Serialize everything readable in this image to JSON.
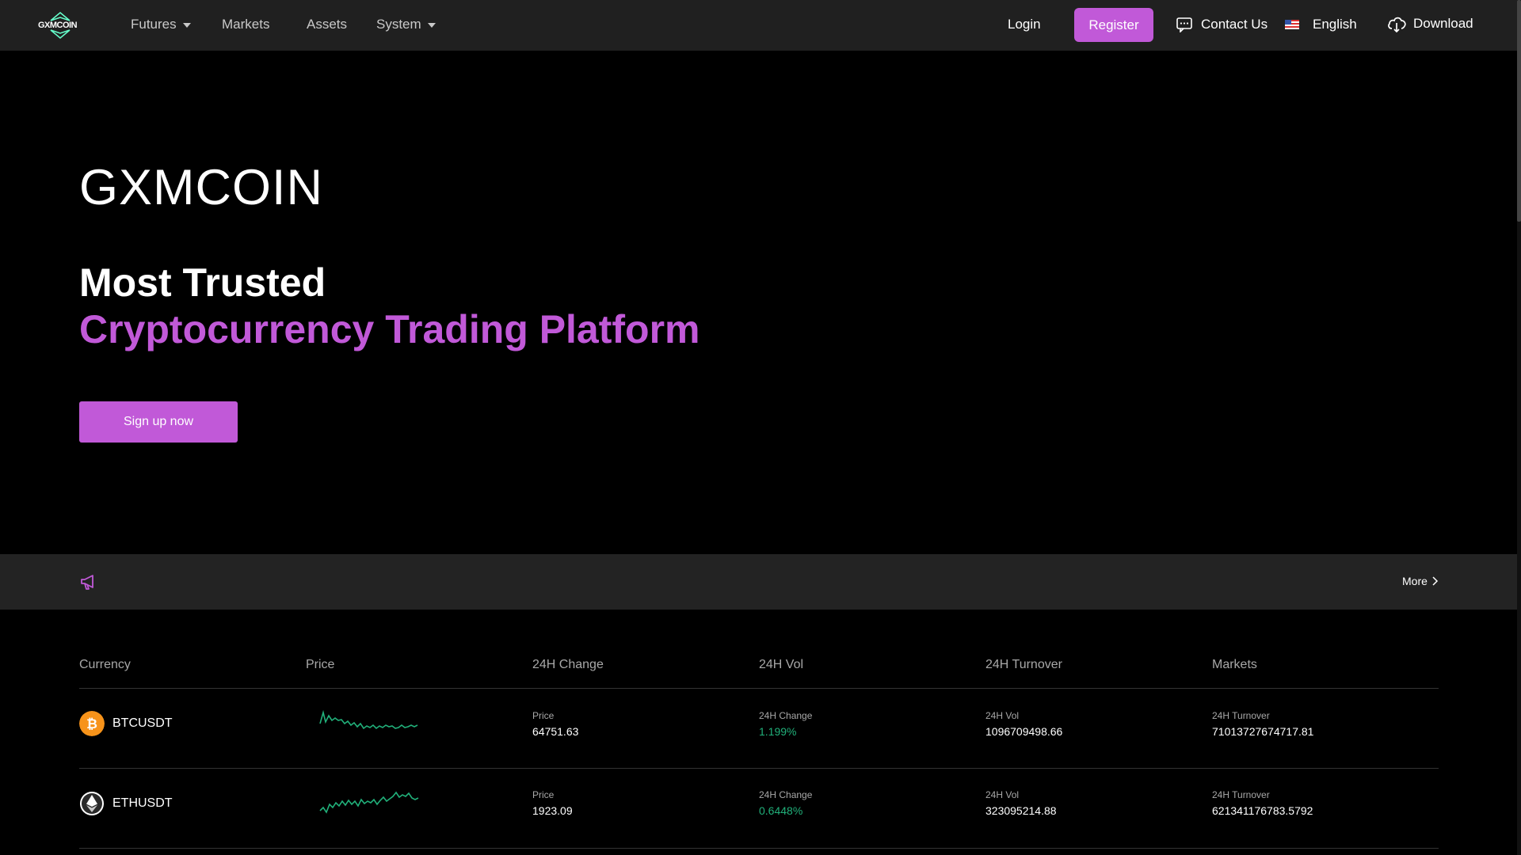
{
  "nav": {
    "logo_text": "GXMCOIN",
    "items": [
      {
        "label": "Futures",
        "dropdown": true
      },
      {
        "label": "Markets",
        "dropdown": false
      },
      {
        "label": "Assets",
        "dropdown": false
      },
      {
        "label": "System",
        "dropdown": true
      }
    ],
    "login": "Login",
    "register": "Register",
    "contact": "Contact Us",
    "language": "English",
    "download": "Download"
  },
  "hero": {
    "brand": "GXMCOIN",
    "headline_1": "Most Trusted",
    "headline_2": "Cryptocurrency Trading Platform",
    "cta": "Sign up now"
  },
  "announcement": {
    "icon": "megaphone-icon",
    "more": "More"
  },
  "market_table": {
    "headers": [
      "Currency",
      "Price",
      "24H Change",
      "24H Vol",
      "24H Turnover",
      "Markets"
    ],
    "rows": [
      {
        "symbol": "BTCUSDT",
        "icon": "bitcoin-icon",
        "price_label": "Price",
        "price": "64751.63",
        "change_label": "24H Change",
        "change": "1.199%",
        "vol_label": "24H Vol",
        "vol": "1096709498.66",
        "turnover_label": "24H Turnover",
        "turnover": "71013727674717.81"
      },
      {
        "symbol": "ETHUSDT",
        "icon": "ethereum-icon",
        "price_label": "Price",
        "price": "1923.09",
        "change_label": "24H Change",
        "change": "0.6448%",
        "vol_label": "24H Vol",
        "vol": "323095214.88",
        "turnover_label": "24H Turnover",
        "turnover": "621341176783.5792"
      }
    ]
  },
  "colors": {
    "accent": "#c159d8",
    "positive": "#21b07a",
    "nav_bg": "#202020",
    "page_bg": "#000000"
  }
}
